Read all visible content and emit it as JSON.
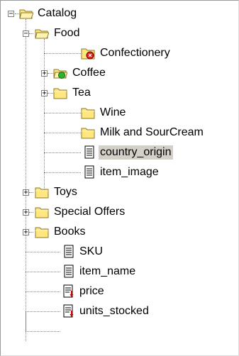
{
  "tree": {
    "root": {
      "label": "Catalog",
      "expander": "−",
      "icon": "open-folder-icon"
    },
    "food": {
      "label": "Food",
      "expander": "−",
      "icon": "open-folder-icon",
      "children": {
        "confectionery": {
          "label": "Confectionery",
          "icon": "folder-red-badge-icon"
        },
        "coffee": {
          "label": "Coffee",
          "expander": "+",
          "icon": "open-folder-green-badge-icon"
        },
        "tea": {
          "label": "Tea",
          "expander": "+",
          "icon": "folder-icon"
        },
        "wine": {
          "label": "Wine",
          "icon": "folder-icon"
        },
        "milk": {
          "label": "Milk and SourCream",
          "icon": "folder-icon"
        },
        "country_origin": {
          "label": "country_origin",
          "icon": "document-icon",
          "selected": true
        },
        "item_image": {
          "label": "item_image",
          "icon": "document-icon"
        }
      }
    },
    "toys": {
      "label": "Toys",
      "expander": "+",
      "icon": "folder-icon"
    },
    "special_offers": {
      "label": "Special Offers",
      "expander": "+",
      "icon": "folder-icon"
    },
    "books": {
      "label": "Books",
      "expander": "+",
      "icon": "folder-icon"
    },
    "sku": {
      "label": "SKU",
      "icon": "document-icon"
    },
    "item_name": {
      "label": "item_name",
      "icon": "document-icon"
    },
    "price": {
      "label": "price",
      "icon": "document-key-icon"
    },
    "units_stocked": {
      "label": "units_stocked",
      "icon": "document-key-icon"
    }
  },
  "colors": {
    "folder_yellow": "#ffe680",
    "folder_outline": "#8c7a2a",
    "selection": "#d4d0c8",
    "tree_line": "#808080",
    "badge_red": "#e02020",
    "badge_green": "#30b030"
  }
}
